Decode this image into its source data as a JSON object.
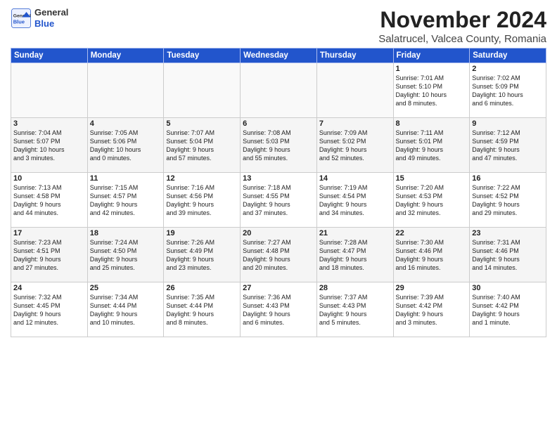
{
  "header": {
    "logo_general": "General",
    "logo_blue": "Blue",
    "title": "November 2024",
    "subtitle": "Salatrucel, Valcea County, Romania"
  },
  "weekdays": [
    "Sunday",
    "Monday",
    "Tuesday",
    "Wednesday",
    "Thursday",
    "Friday",
    "Saturday"
  ],
  "weeks": [
    [
      {
        "day": "",
        "info": ""
      },
      {
        "day": "",
        "info": ""
      },
      {
        "day": "",
        "info": ""
      },
      {
        "day": "",
        "info": ""
      },
      {
        "day": "",
        "info": ""
      },
      {
        "day": "1",
        "info": "Sunrise: 7:01 AM\nSunset: 5:10 PM\nDaylight: 10 hours\nand 8 minutes."
      },
      {
        "day": "2",
        "info": "Sunrise: 7:02 AM\nSunset: 5:09 PM\nDaylight: 10 hours\nand 6 minutes."
      }
    ],
    [
      {
        "day": "3",
        "info": "Sunrise: 7:04 AM\nSunset: 5:07 PM\nDaylight: 10 hours\nand 3 minutes."
      },
      {
        "day": "4",
        "info": "Sunrise: 7:05 AM\nSunset: 5:06 PM\nDaylight: 10 hours\nand 0 minutes."
      },
      {
        "day": "5",
        "info": "Sunrise: 7:07 AM\nSunset: 5:04 PM\nDaylight: 9 hours\nand 57 minutes."
      },
      {
        "day": "6",
        "info": "Sunrise: 7:08 AM\nSunset: 5:03 PM\nDaylight: 9 hours\nand 55 minutes."
      },
      {
        "day": "7",
        "info": "Sunrise: 7:09 AM\nSunset: 5:02 PM\nDaylight: 9 hours\nand 52 minutes."
      },
      {
        "day": "8",
        "info": "Sunrise: 7:11 AM\nSunset: 5:01 PM\nDaylight: 9 hours\nand 49 minutes."
      },
      {
        "day": "9",
        "info": "Sunrise: 7:12 AM\nSunset: 4:59 PM\nDaylight: 9 hours\nand 47 minutes."
      }
    ],
    [
      {
        "day": "10",
        "info": "Sunrise: 7:13 AM\nSunset: 4:58 PM\nDaylight: 9 hours\nand 44 minutes."
      },
      {
        "day": "11",
        "info": "Sunrise: 7:15 AM\nSunset: 4:57 PM\nDaylight: 9 hours\nand 42 minutes."
      },
      {
        "day": "12",
        "info": "Sunrise: 7:16 AM\nSunset: 4:56 PM\nDaylight: 9 hours\nand 39 minutes."
      },
      {
        "day": "13",
        "info": "Sunrise: 7:18 AM\nSunset: 4:55 PM\nDaylight: 9 hours\nand 37 minutes."
      },
      {
        "day": "14",
        "info": "Sunrise: 7:19 AM\nSunset: 4:54 PM\nDaylight: 9 hours\nand 34 minutes."
      },
      {
        "day": "15",
        "info": "Sunrise: 7:20 AM\nSunset: 4:53 PM\nDaylight: 9 hours\nand 32 minutes."
      },
      {
        "day": "16",
        "info": "Sunrise: 7:22 AM\nSunset: 4:52 PM\nDaylight: 9 hours\nand 29 minutes."
      }
    ],
    [
      {
        "day": "17",
        "info": "Sunrise: 7:23 AM\nSunset: 4:51 PM\nDaylight: 9 hours\nand 27 minutes."
      },
      {
        "day": "18",
        "info": "Sunrise: 7:24 AM\nSunset: 4:50 PM\nDaylight: 9 hours\nand 25 minutes."
      },
      {
        "day": "19",
        "info": "Sunrise: 7:26 AM\nSunset: 4:49 PM\nDaylight: 9 hours\nand 23 minutes."
      },
      {
        "day": "20",
        "info": "Sunrise: 7:27 AM\nSunset: 4:48 PM\nDaylight: 9 hours\nand 20 minutes."
      },
      {
        "day": "21",
        "info": "Sunrise: 7:28 AM\nSunset: 4:47 PM\nDaylight: 9 hours\nand 18 minutes."
      },
      {
        "day": "22",
        "info": "Sunrise: 7:30 AM\nSunset: 4:46 PM\nDaylight: 9 hours\nand 16 minutes."
      },
      {
        "day": "23",
        "info": "Sunrise: 7:31 AM\nSunset: 4:46 PM\nDaylight: 9 hours\nand 14 minutes."
      }
    ],
    [
      {
        "day": "24",
        "info": "Sunrise: 7:32 AM\nSunset: 4:45 PM\nDaylight: 9 hours\nand 12 minutes."
      },
      {
        "day": "25",
        "info": "Sunrise: 7:34 AM\nSunset: 4:44 PM\nDaylight: 9 hours\nand 10 minutes."
      },
      {
        "day": "26",
        "info": "Sunrise: 7:35 AM\nSunset: 4:44 PM\nDaylight: 9 hours\nand 8 minutes."
      },
      {
        "day": "27",
        "info": "Sunrise: 7:36 AM\nSunset: 4:43 PM\nDaylight: 9 hours\nand 6 minutes."
      },
      {
        "day": "28",
        "info": "Sunrise: 7:37 AM\nSunset: 4:43 PM\nDaylight: 9 hours\nand 5 minutes."
      },
      {
        "day": "29",
        "info": "Sunrise: 7:39 AM\nSunset: 4:42 PM\nDaylight: 9 hours\nand 3 minutes."
      },
      {
        "day": "30",
        "info": "Sunrise: 7:40 AM\nSunset: 4:42 PM\nDaylight: 9 hours\nand 1 minute."
      }
    ]
  ]
}
